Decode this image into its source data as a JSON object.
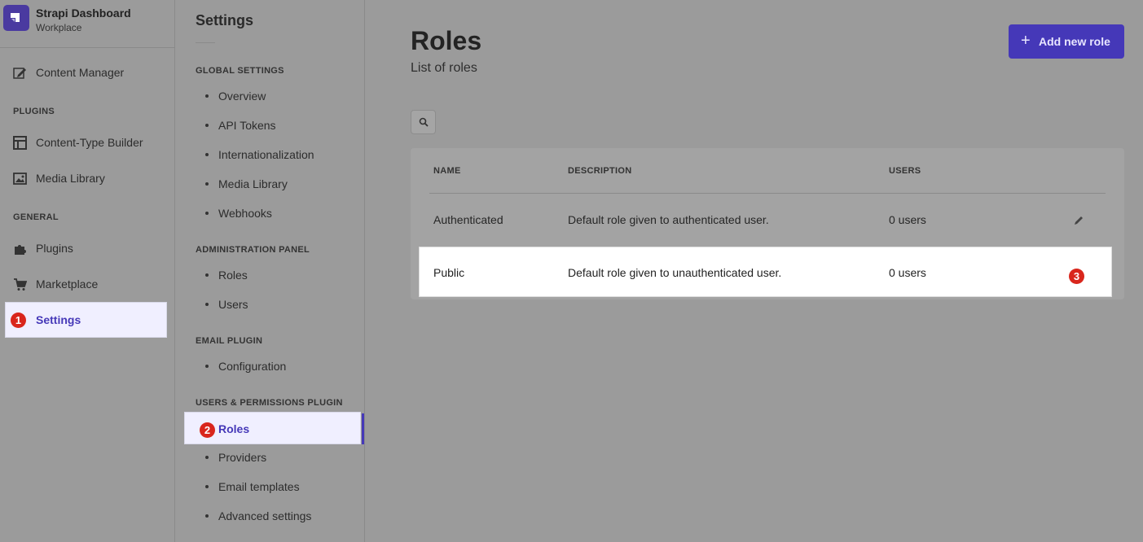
{
  "brand": {
    "title": "Strapi Dashboard",
    "subtitle": "Workplace"
  },
  "main_nav": {
    "content_manager": "Content Manager",
    "plugins_section": "PLUGINS",
    "content_type_builder": "Content-Type Builder",
    "media_library": "Media Library",
    "general_section": "GENERAL",
    "plugins": "Plugins",
    "marketplace": "Marketplace",
    "settings": "Settings"
  },
  "steps": {
    "one": "1",
    "two": "2",
    "three": "3"
  },
  "settings_nav": {
    "title": "Settings",
    "global_section": "GLOBAL SETTINGS",
    "global_items": [
      "Overview",
      "API Tokens",
      "Internationalization",
      "Media Library",
      "Webhooks"
    ],
    "admin_section": "ADMINISTRATION PANEL",
    "admin_items": [
      "Roles",
      "Users"
    ],
    "email_section": "EMAIL PLUGIN",
    "email_items": [
      "Configuration"
    ],
    "users_section": "USERS & PERMISSIONS PLUGIN",
    "users_items": [
      "Roles",
      "Providers",
      "Email templates",
      "Advanced settings"
    ]
  },
  "page": {
    "title": "Roles",
    "subtitle": "List of roles",
    "add_button": "Add new role"
  },
  "table": {
    "headers": {
      "name": "NAME",
      "description": "DESCRIPTION",
      "users": "USERS"
    },
    "rows": [
      {
        "name": "Authenticated",
        "description": "Default role given to authenticated user.",
        "users": "0 users"
      },
      {
        "name": "Public",
        "description": "Default role given to unauthenticated user.",
        "users": "0 users"
      }
    ]
  },
  "colors": {
    "accent": "#4538b8",
    "marker": "#d9261c",
    "highlight_bg": "#f0efff"
  }
}
